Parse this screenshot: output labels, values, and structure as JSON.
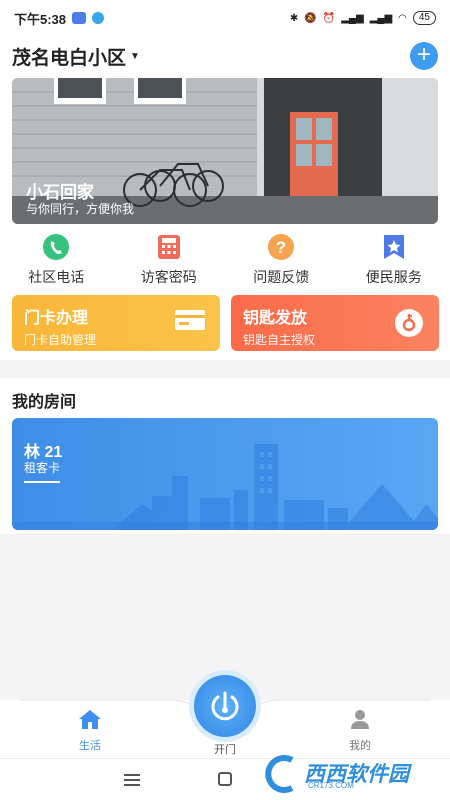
{
  "status": {
    "time": "下午5:38",
    "battery": "45"
  },
  "header": {
    "title": "茂名电白小区"
  },
  "banner": {
    "title": "小石回家",
    "subtitle": "与你同行，方便你我"
  },
  "quick_actions": [
    {
      "label": "社区电话",
      "icon": "phone-icon"
    },
    {
      "label": "访客密码",
      "icon": "keypad-icon"
    },
    {
      "label": "问题反馈",
      "icon": "question-icon"
    },
    {
      "label": "便民服务",
      "icon": "star-bookmark-icon"
    }
  ],
  "cards": {
    "door": {
      "title": "门卡办理",
      "subtitle": "门卡自助管理"
    },
    "key": {
      "title": "钥匙发放",
      "subtitle": "钥匙自主授权"
    }
  },
  "rooms": {
    "section_title": "我的房间",
    "items": [
      {
        "name": "林 21",
        "type": "租客卡"
      }
    ]
  },
  "tabbar": {
    "life": "生活",
    "open": "开门",
    "mine": "我的"
  },
  "watermark": {
    "text": "西西软件园",
    "sub": "CR173.COM"
  },
  "colors": {
    "accent": "#3f8ff0",
    "door_card": "#f9b638",
    "key_card": "#f96b4a"
  }
}
